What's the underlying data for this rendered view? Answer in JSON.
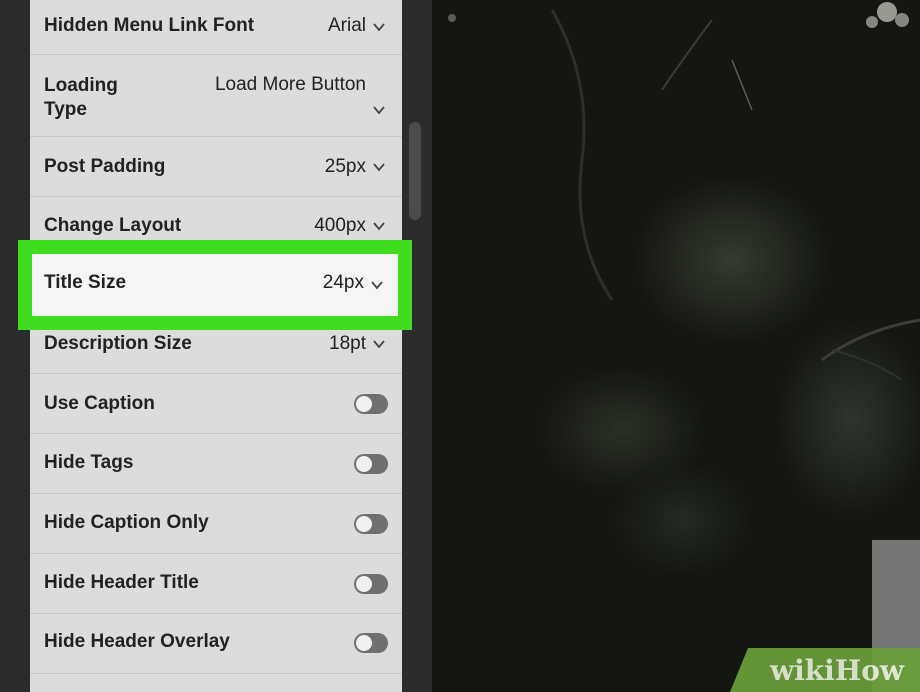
{
  "settings": {
    "rows": [
      {
        "label": "Hidden Menu Link Font",
        "value": "Arial",
        "control": "select"
      },
      {
        "label": "Loading Type",
        "value": "Load More Button",
        "control": "select"
      },
      {
        "label": "Post Padding",
        "value": "25px",
        "control": "select"
      },
      {
        "label": "Change Layout",
        "value": "400px",
        "control": "select"
      },
      {
        "label": "Title Size",
        "value": "24px",
        "control": "select",
        "highlighted": true
      },
      {
        "label": "Description Size",
        "value": "18pt",
        "control": "select"
      },
      {
        "label": "Use Caption",
        "value": "off",
        "control": "toggle"
      },
      {
        "label": "Hide Tags",
        "value": "off",
        "control": "toggle"
      },
      {
        "label": "Hide Caption Only",
        "value": "off",
        "control": "toggle"
      },
      {
        "label": "Hide Header Title",
        "value": "off",
        "control": "toggle"
      },
      {
        "label": "Hide Header Overlay",
        "value": "off",
        "control": "toggle"
      }
    ]
  },
  "highlight_color": "#3fdc1f",
  "watermark": "wikiHow"
}
